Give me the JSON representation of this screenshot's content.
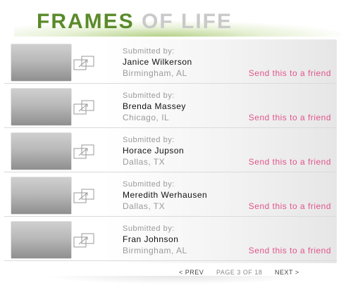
{
  "header": {
    "title_part1": "FRAMES",
    "title_part2": "OF LIFE"
  },
  "submissions": [
    {
      "submitted_label": "Submitted by:",
      "name": "Janice Wilkerson",
      "location": "Birmingham, AL",
      "send_label": "Send this to a friend"
    },
    {
      "submitted_label": "Submitted by:",
      "name": "Brenda Massey",
      "location": "Chicago, IL",
      "send_label": "Send this to a friend"
    },
    {
      "submitted_label": "Submitted by:",
      "name": "Horace Jupson",
      "location": "Dallas, TX",
      "send_label": "Send this to a friend"
    },
    {
      "submitted_label": "Submitted by:",
      "name": "Meredith Werhausen",
      "location": "Dallas, TX",
      "send_label": "Send this to a friend"
    },
    {
      "submitted_label": "Submitted by:",
      "name": "Fran Johnson",
      "location": "Birmingham, AL",
      "send_label": "Send this to a friend"
    }
  ],
  "pagination": {
    "prev_label": "< PREV",
    "page_info": "PAGE 3 OF 18",
    "next_label": "NEXT >"
  },
  "icons": {
    "thumbnail": "photo-thumbnail",
    "enlarge": "enlarge-frame-icon"
  },
  "colors": {
    "title_green": "#5a8a2a",
    "title_gray": "#c9c9c9",
    "link_pink": "#e0558a"
  }
}
